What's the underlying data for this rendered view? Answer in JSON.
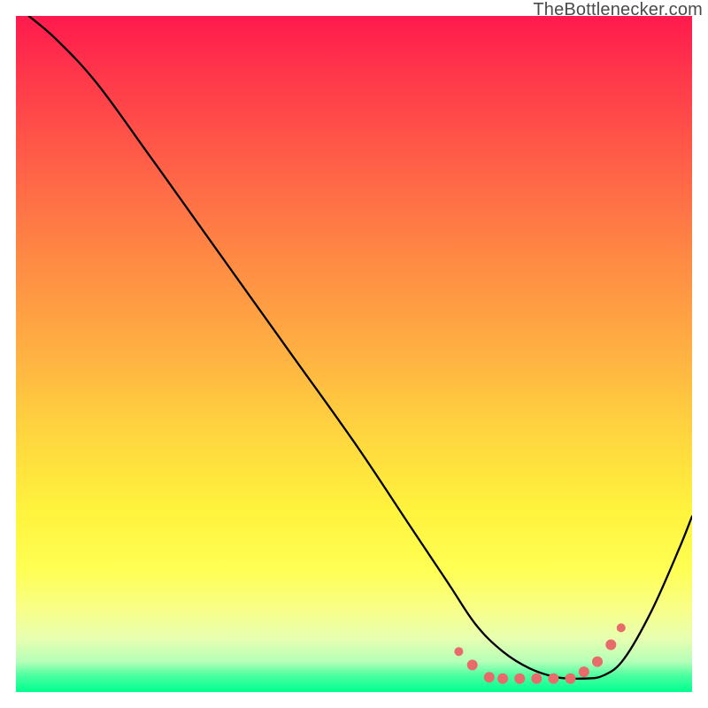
{
  "watermark_text": "TheBottlenecker.com",
  "chart_data": {
    "type": "line",
    "title": "",
    "xlabel": "",
    "ylabel": "",
    "xlim": [
      0,
      1
    ],
    "ylim": [
      0,
      1
    ],
    "gradient": {
      "direction": "vertical",
      "stops": [
        {
          "pos": 0.0,
          "color": "#ff1a4d"
        },
        {
          "pos": 0.24,
          "color": "#ff6647"
        },
        {
          "pos": 0.5,
          "color": "#ffb142"
        },
        {
          "pos": 0.73,
          "color": "#fff33d"
        },
        {
          "pos": 0.92,
          "color": "#e8ffb0"
        },
        {
          "pos": 1.0,
          "color": "#00ff91"
        }
      ]
    },
    "series": [
      {
        "name": "bottleneck-curve",
        "x": [
          0.019,
          0.06,
          0.12,
          0.2,
          0.3,
          0.4,
          0.5,
          0.58,
          0.64,
          0.68,
          0.72,
          0.76,
          0.8,
          0.84,
          0.87,
          0.9,
          0.94,
          0.98,
          1.0
        ],
        "y": [
          1.0,
          0.965,
          0.9,
          0.79,
          0.65,
          0.51,
          0.37,
          0.25,
          0.16,
          0.1,
          0.06,
          0.035,
          0.022,
          0.02,
          0.025,
          0.05,
          0.12,
          0.21,
          0.26
        ]
      }
    ],
    "markers": {
      "color": "#e86a6a",
      "radius_main": 6,
      "radius_end": 5,
      "points_xy": [
        [
          0.655,
          0.06
        ],
        [
          0.675,
          0.04
        ],
        [
          0.7,
          0.022
        ],
        [
          0.72,
          0.02
        ],
        [
          0.745,
          0.02
        ],
        [
          0.77,
          0.02
        ],
        [
          0.795,
          0.02
        ],
        [
          0.82,
          0.02
        ],
        [
          0.84,
          0.03
        ],
        [
          0.86,
          0.045
        ],
        [
          0.88,
          0.07
        ],
        [
          0.895,
          0.095
        ]
      ]
    }
  }
}
